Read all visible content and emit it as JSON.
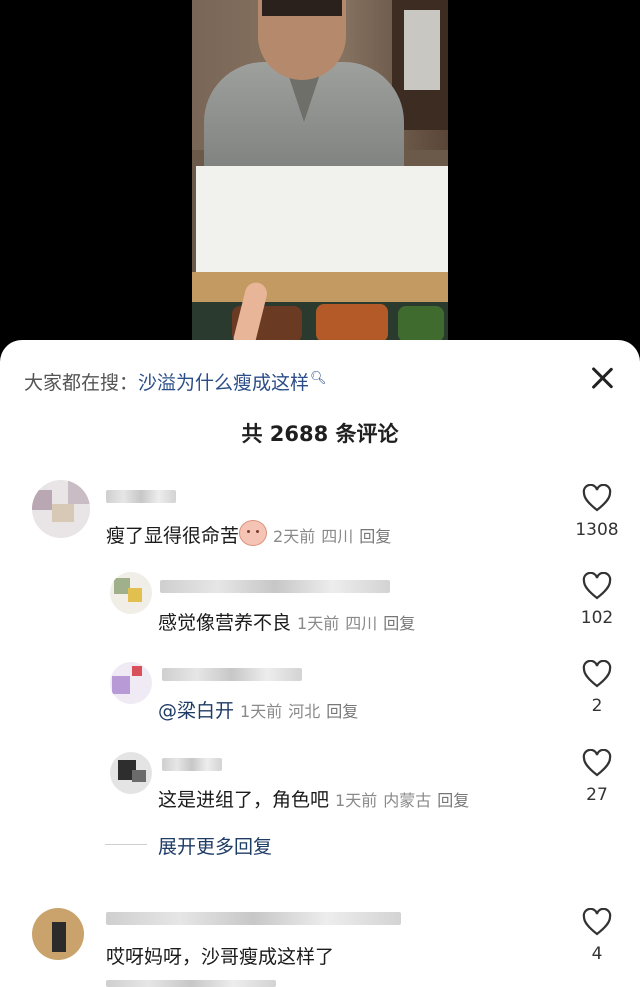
{
  "search": {
    "prefix": "大家都在搜：",
    "keyword": "沙溢为什么瘦成这样"
  },
  "comments_header": {
    "total_label": "共 2688 条评论"
  },
  "comments": [
    {
      "text": "瘦了显得很命苦",
      "time": "2天前",
      "location": "四川",
      "reply": "回复",
      "likes": "1308"
    },
    {
      "text": "感觉像营养不良",
      "time": "1天前",
      "location": "四川",
      "reply": "回复",
      "likes": "102"
    },
    {
      "text": "@梁白开",
      "time": "1天前",
      "location": "河北",
      "reply": "回复",
      "likes": "2"
    },
    {
      "text": "这是进组了，角色吧",
      "time": "1天前",
      "location": "内蒙古",
      "reply": "回复",
      "likes": "27"
    },
    {
      "text": "哎呀妈呀，沙哥瘦成这样了",
      "likes": "4"
    }
  ],
  "expand_replies": "展开更多回复",
  "icons": {
    "close": "close-icon",
    "like": "heart-icon",
    "search": "search-icon"
  },
  "colors": {
    "keyword": "#2c4e88",
    "meta": "#8a8a8a",
    "sheet": "#ffffff"
  }
}
